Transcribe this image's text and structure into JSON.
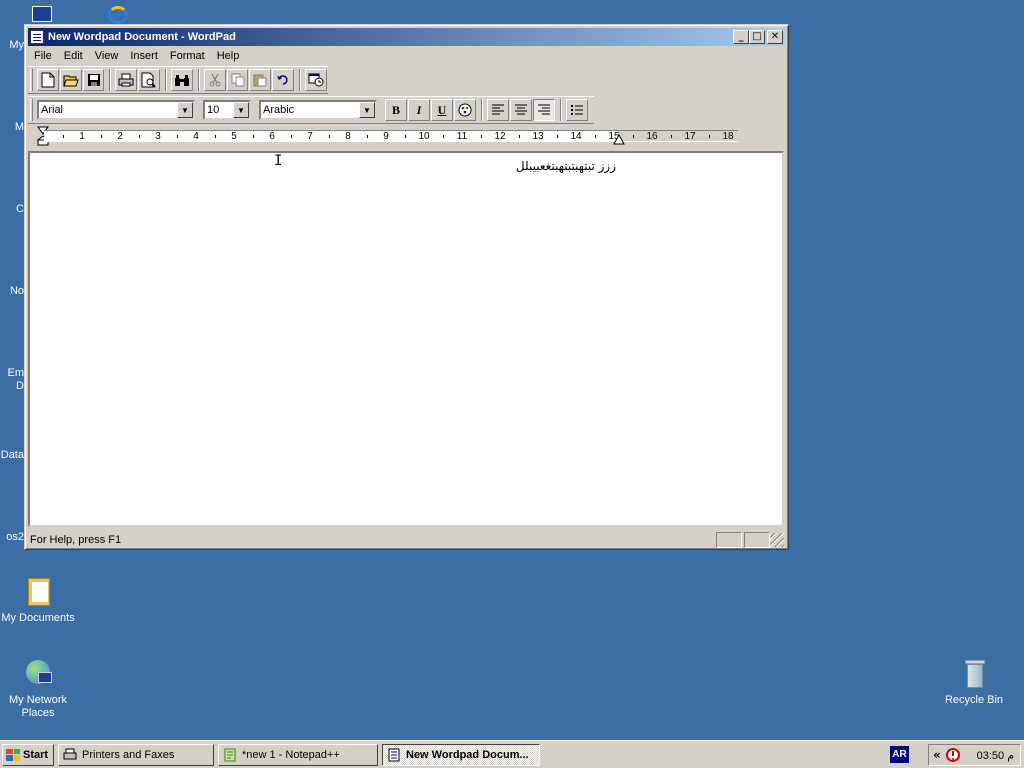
{
  "window": {
    "title": "New Wordpad Document - WordPad",
    "minimize_glyph": "_",
    "maximize_glyph": "□",
    "close_glyph": "✕"
  },
  "menu": [
    "File",
    "Edit",
    "View",
    "Insert",
    "Format",
    "Help"
  ],
  "format_bar": {
    "font": "Arial",
    "size": "10",
    "script": "Arabic",
    "bold": "B",
    "italic": "I",
    "underline": "U"
  },
  "ruler": {
    "numbers": [
      "1",
      "2",
      "3",
      "4",
      "5",
      "6",
      "7",
      "8",
      "9",
      "10",
      "11",
      "12",
      "13",
      "14",
      "15",
      "16",
      "17",
      "18"
    ]
  },
  "document": {
    "text": "ززز  تبتهبتبتهبتغعبيبلل"
  },
  "status": {
    "help_text": "For Help, press F1"
  },
  "desktop": {
    "icons": [
      {
        "label": "My Documents"
      },
      {
        "label": "My Network Places"
      },
      {
        "label": "Recycle Bin"
      }
    ],
    "partial_labels": [
      "My",
      "M",
      "C",
      "No",
      "Em",
      "D",
      "Data",
      "os2"
    ]
  },
  "taskbar": {
    "start_label": "Start",
    "tasks": [
      {
        "label": "Printers and Faxes"
      },
      {
        "label": "*new 1 - Notepad++"
      },
      {
        "label": "New Wordpad Docum..."
      }
    ],
    "language": "AR",
    "tray_chevron": "«",
    "clock": "03:50 م"
  },
  "colors": {
    "desktop": "#3a6ea5",
    "titlebar_start": "#0a246a",
    "titlebar_end": "#a6caf0",
    "face": "#d4d0c8"
  }
}
